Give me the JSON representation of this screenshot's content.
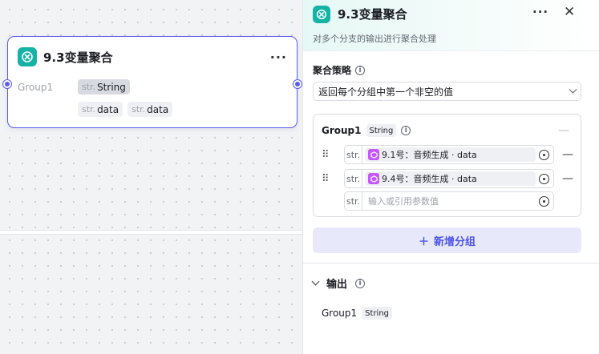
{
  "node": {
    "title": "9.3变量聚合",
    "group_label": "Group1",
    "type_prefix": "str.",
    "type_name": "String",
    "vars": [
      {
        "prefix": "str.",
        "name": "data"
      },
      {
        "prefix": "str.",
        "name": "data"
      }
    ]
  },
  "panel": {
    "title": "9.3变量聚合",
    "description": "对多个分支的输出进行聚合处理",
    "strategy_label": "聚合策略",
    "strategy_value": "返回每个分组中第一个非空的值",
    "group": {
      "name": "Group1",
      "type": "String",
      "rows": [
        {
          "type": "str.",
          "ref": "9.1号：音频生成 · data"
        },
        {
          "type": "str.",
          "ref": "9.4号：音频生成 · data"
        }
      ],
      "empty_row": {
        "type": "str.",
        "placeholder": "输入或引用参数值"
      }
    },
    "add_group_label": "新增分组",
    "output": {
      "label": "输出",
      "name": "Group1",
      "type": "String"
    }
  },
  "colors": {
    "accent": "#4d53e8",
    "node_border": "#5a5cf0",
    "brand_teal": "#15b2a6",
    "ref_purple": "#c557ff"
  },
  "icons": [
    "aggregate-icon",
    "more-icon",
    "close-icon",
    "info-icon",
    "chevron-down-icon",
    "drag-handle-icon",
    "variable-ref-icon",
    "target-icon",
    "minus-icon",
    "plus-icon"
  ]
}
